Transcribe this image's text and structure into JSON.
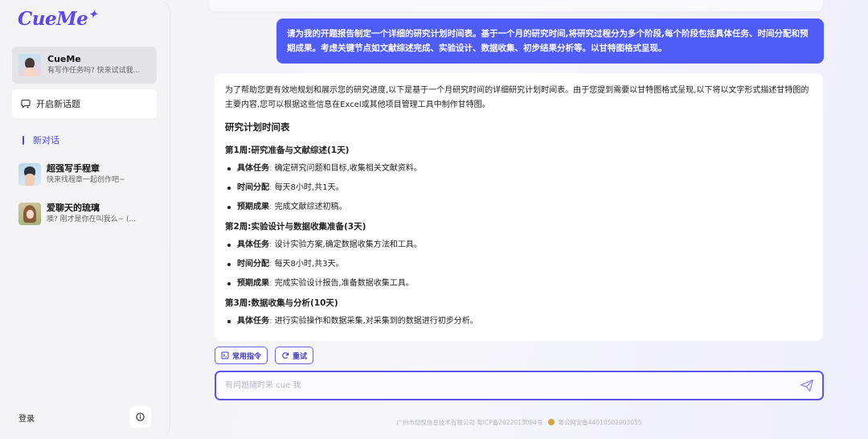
{
  "sidebar": {
    "logo": "CueMe",
    "logo_mark": "✦",
    "active_agent": {
      "name": "CueMe",
      "subtitle": "有写作任务吗? 快来试试我..."
    },
    "new_topic_label": "开启新话题",
    "section_title": "新对话",
    "chats": [
      {
        "name": "超强写手程章",
        "subtitle": "快来找程章一起创作吧~"
      },
      {
        "name": "爱聊天的琉璃",
        "subtitle": "噢? 刚才是你在叫我么~ (..."
      }
    ],
    "login_label": "登录"
  },
  "conversation": {
    "user_message": "请为我的开题报告制定一个详细的研究计划时间表。基于一个月的研究时间,将研究过程分为多个阶段,每个阶段包括具体任务、时间分配和预期成果。考虑关键节点如文献综述完成、实验设计、数据收集、初步结果分析等。以甘特图格式呈现。",
    "answer": {
      "intro": "为了帮助您更有效地规划和展示您的研究进度,以下是基于一个月研究时间的详细研究计划时间表。由于您提到需要以甘特图格式呈现,以下将以文字形式描述甘特图的主要内容,您可以根据这些信息在Excel或其他项目管理工具中制作甘特图。",
      "heading": "研究计划时间表",
      "weeks": [
        {
          "title": "第1周:研究准备与文献综述(1天)",
          "items": [
            {
              "label": "具体任务",
              "text": "确定研究问题和目标,收集相关文献资料。"
            },
            {
              "label": "时间分配",
              "text": "每天8小时,共1天。"
            },
            {
              "label": "预期成果",
              "text": "完成文献综述初稿。"
            }
          ]
        },
        {
          "title": "第2周:实验设计与数据收集准备(3天)",
          "items": [
            {
              "label": "具体任务",
              "text": "设计实验方案,确定数据收集方法和工具。"
            },
            {
              "label": "时间分配",
              "text": "每天8小时,共3天。"
            },
            {
              "label": "预期成果",
              "text": "完成实验设计报告,准备数据收集工具。"
            }
          ]
        },
        {
          "title": "第3周:数据收集与分析(10天)",
          "items": [
            {
              "label": "具体任务",
              "text": "进行实验操作和数据采集,对采集到的数据进行初步分析。"
            }
          ]
        }
      ]
    }
  },
  "actions": {
    "common_commands": "常用指令",
    "retry": "重试"
  },
  "input": {
    "placeholder": "有问题随时来 cue 我",
    "value": ""
  },
  "footer": {
    "company": "广州市动悦信息技术有限公司 粤ICP备2022013084号",
    "police": "粤公网安备44010502003055"
  },
  "colors": {
    "accent": "#5b55ec",
    "user_bubble": "#4f5cf6",
    "logo": "#5b46f0"
  }
}
